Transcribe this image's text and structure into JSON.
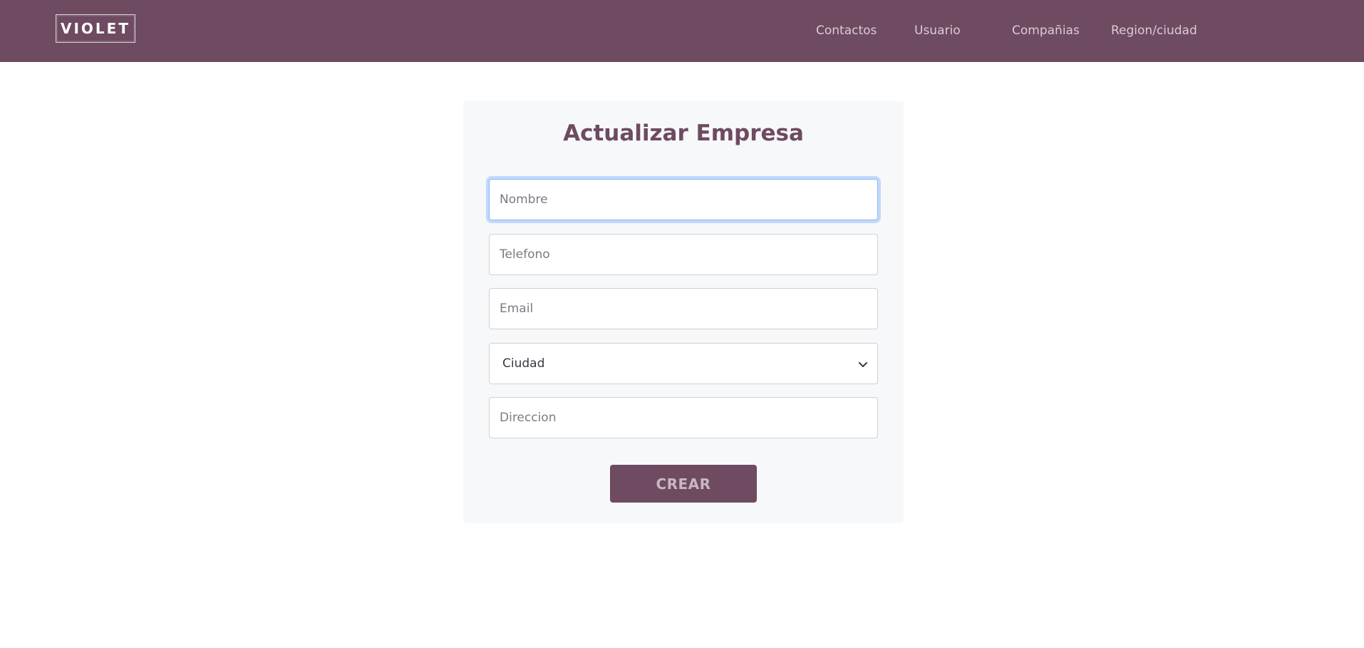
{
  "brand": {
    "logo_text": "VIOLET"
  },
  "nav": {
    "items": [
      {
        "label": "Contactos"
      },
      {
        "label": "Usuario"
      },
      {
        "label": "Compañias"
      },
      {
        "label": "Region/ciudad"
      }
    ]
  },
  "form": {
    "title": "Actualizar Empresa",
    "fields": {
      "nombre": {
        "placeholder": "Nombre",
        "value": ""
      },
      "telefono": {
        "placeholder": "Telefono",
        "value": ""
      },
      "email": {
        "placeholder": "Email",
        "value": ""
      },
      "ciudad": {
        "selected": "Ciudad"
      },
      "direccion": {
        "placeholder": "Direccion",
        "value": ""
      }
    },
    "submit_label": "CREAR"
  },
  "colors": {
    "brand": "#6e4b61",
    "card_background": "#f7f8fa",
    "focus_ring": "#86b7fe"
  },
  "icons": {
    "select_arrow": "chevron-down-icon"
  }
}
